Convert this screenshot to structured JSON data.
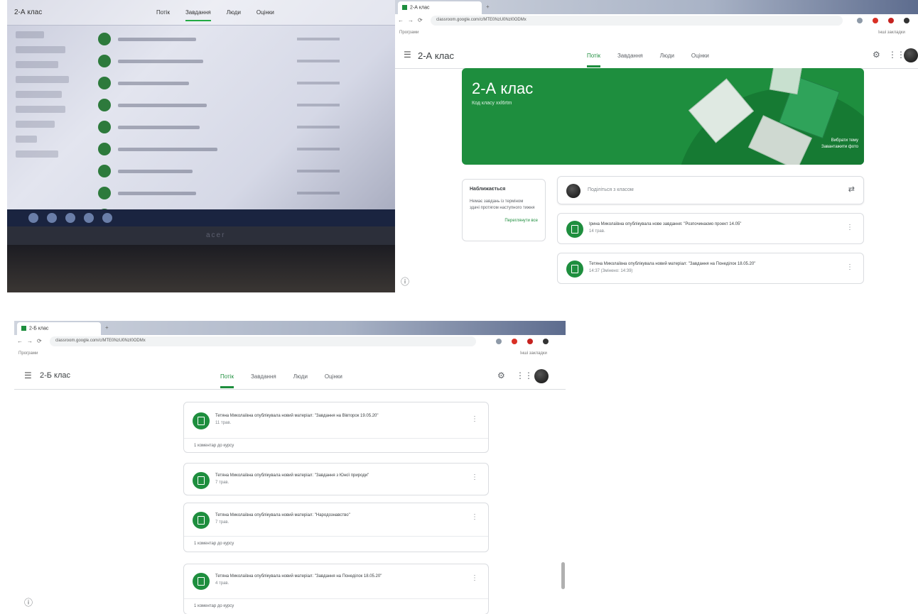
{
  "photo": {
    "app_title": "2-А клас",
    "tabs": [
      "Потік",
      "Завдання",
      "Люди",
      "Оцінки"
    ],
    "brand": "acer"
  },
  "browser_top": {
    "tab_label": "2-А клас",
    "url": "classroom.google.com/c/MTE0NzU0NzI0ODMx",
    "bookmarks": "Програми",
    "other_bookmarks": "Інші закладки",
    "class_name": "2-А клас",
    "tabs": [
      "Потік",
      "Завдання",
      "Люди",
      "Оцінки"
    ],
    "banner_title": "2-А клас",
    "banner_subtitle": "Код класу xxl6rtm",
    "banner_select": "Вибрати тему",
    "banner_upload": "Завантажити фото",
    "upcoming_title": "Наближається",
    "upcoming_line1": "Немає завдань із терміном",
    "upcoming_line2": "здачі протягом наступного тижня",
    "upcoming_link": "Переглянути все",
    "share_placeholder": "Поділіться з класом",
    "posts": [
      {
        "title": "Ірина Миколаївна опублікувала нове завдання: \"Розпочинаємо проект 14.05\"",
        "date": "14 трав."
      },
      {
        "title": "Тетяна Миколаївна опублікувала новий матеріал: \"Завдання на Понеділок 18.05.20\"",
        "date": "14:37 (Змінено: 14:39)"
      }
    ]
  },
  "browser_bottom": {
    "tab_label": "2-Б клас",
    "url": "classroom.google.com/c/MTE0NzU0NzI0ODMx",
    "bookmarks": "Програми",
    "other_bookmarks": "Інші закладки",
    "class_name": "2-Б клас",
    "tabs": [
      "Потік",
      "Завдання",
      "Люди",
      "Оцінки"
    ],
    "posts": [
      {
        "title": "Тетяна Миколаївна опублікувала новий матеріал: \"Завдання на Вівторок 19.05.20\"",
        "date": "11 трав.",
        "comment": "1 коментар до курсу"
      },
      {
        "title": "Тетяна Миколаївна опублікувала новий матеріал: \"Завдання з Юної природи\"",
        "date": "7 трав.",
        "comment": ""
      },
      {
        "title": "Тетяна Миколаївна опублікувала новий матеріал: \"Народознавство\"",
        "date": "7 трав.",
        "comment": "1 коментар до курсу"
      },
      {
        "title": "Тетяна Миколаївна опублікувала новий матеріал: \"Завдання на Понеділок 18.05.20\"",
        "date": "4 трав.",
        "comment": "1 коментар до курсу"
      }
    ]
  }
}
